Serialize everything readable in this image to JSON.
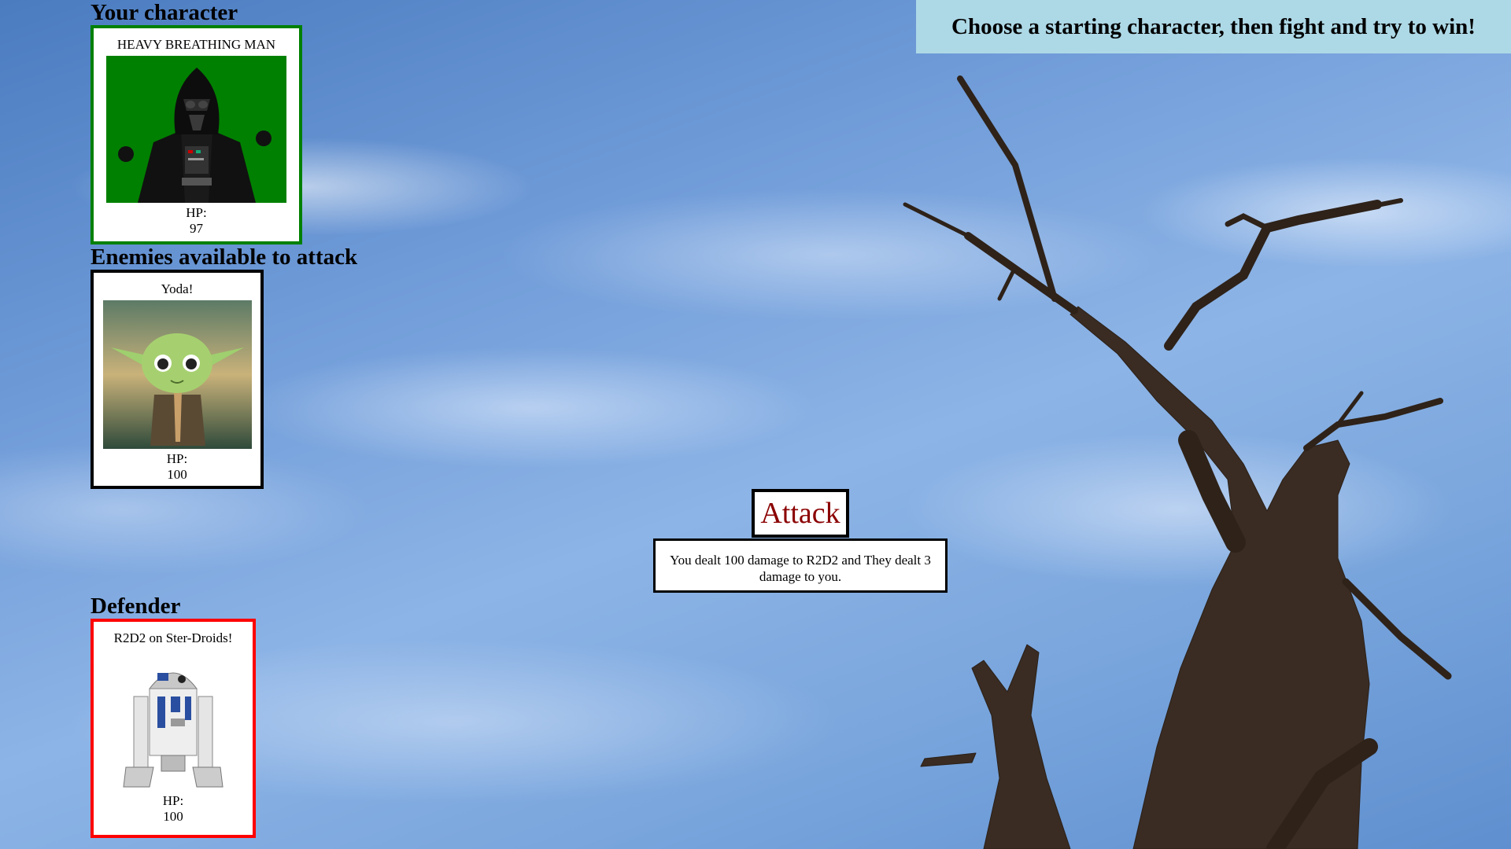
{
  "banner": {
    "text": "Choose a starting character, then fight and try to win!"
  },
  "sections": {
    "your_character": "Your character",
    "enemies": "Enemies available to attack",
    "defender": "Defender"
  },
  "player": {
    "name": "HEAVY BREATHING MAN",
    "hp_label": "HP:",
    "hp": "97",
    "border_color": "#008000"
  },
  "enemies": [
    {
      "name": "Yoda!",
      "hp_label": "HP:",
      "hp": "100",
      "border_color": "#000000"
    }
  ],
  "defender": {
    "name": "R2D2 on Ster-Droids!",
    "hp_label": "HP:",
    "hp": "100",
    "border_color": "#ff0000"
  },
  "attack": {
    "label": "Attack",
    "color": "#8b0000"
  },
  "message": {
    "text": "You dealt 100 damage to R2D2 and They dealt 3 damage to you."
  },
  "colors": {
    "banner_bg": "#add8e6",
    "sky": "#6f9bd8"
  }
}
